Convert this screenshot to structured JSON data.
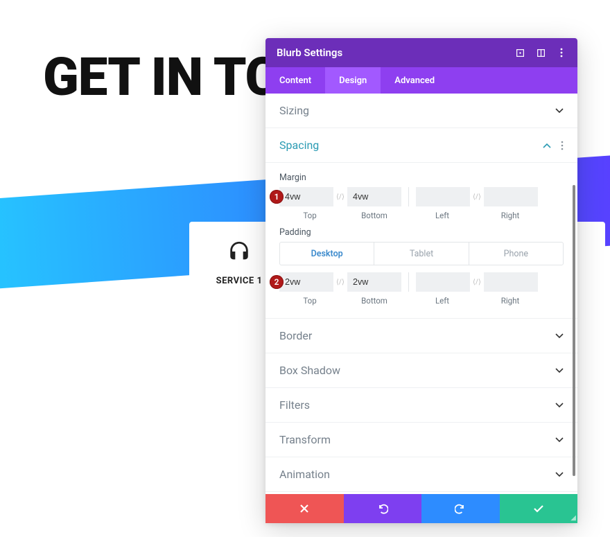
{
  "background": {
    "heading": "GET IN TC",
    "service_label": "SERVICE 1"
  },
  "panel": {
    "title": "Blurb Settings",
    "tabs": {
      "content": "Content",
      "design": "Design",
      "advanced": "Advanced"
    },
    "sections": {
      "sizing": "Sizing",
      "spacing": "Spacing",
      "margin_label": "Margin",
      "padding_label": "Padding",
      "border": "Border",
      "box_shadow": "Box Shadow",
      "filters": "Filters",
      "transform": "Transform",
      "animation": "Animation"
    },
    "spacing": {
      "margin": {
        "top": "4vw",
        "bottom": "4vw",
        "left": "",
        "right": ""
      },
      "padding": {
        "top": "2vw",
        "bottom": "2vw",
        "left": "",
        "right": ""
      },
      "labels": {
        "top": "Top",
        "bottom": "Bottom",
        "left": "Left",
        "right": "Right"
      },
      "devices": {
        "desktop": "Desktop",
        "tablet": "Tablet",
        "phone": "Phone"
      }
    },
    "markers": {
      "m1": "1",
      "m2": "2"
    }
  }
}
